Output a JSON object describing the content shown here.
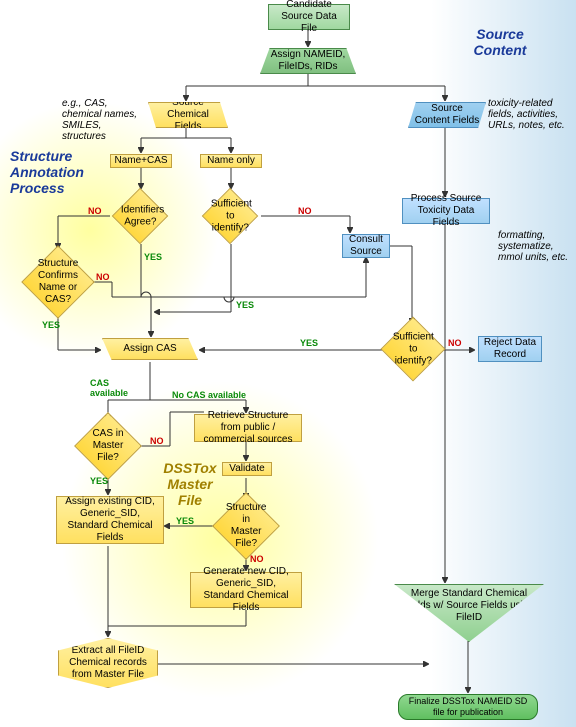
{
  "titles": {
    "left": "Structure Annotation Process",
    "right": "Source Content",
    "master": "DSSTox Master File"
  },
  "nodes": {
    "start": "Candidate Source Data File",
    "assign_ids": "Assign NAMEID, FileIDs, RIDs",
    "src_chem": "Source Chemical Fields",
    "src_cont": "Source Content Fields",
    "name_cas": "Name+CAS",
    "name_only": "Name only",
    "id_agree": "Identifiers Agree?",
    "suff1": "Sufficient to identify?",
    "struct_conf": "Structure Confirms Name or CAS?",
    "consult": "Consult Source",
    "suff2": "Sufficient to identify?",
    "reject": "Reject Data Record",
    "process_tox": "Process Source Toxicity Data Fields",
    "assign_cas": "Assign CAS",
    "cas_master": "CAS in Master File?",
    "retrieve": "Retrieve Structure from public / commercial sources",
    "validate": "Validate",
    "struct_master": "Structure in Master File?",
    "assign_exist": "Assign existing CID, Generic_SID, Standard Chemical Fields",
    "gen_new": "Generate new CID, Generic_SID, Standard Chemical Fields",
    "extract": "Extract all FileID Chemical records from Master File",
    "merge": "Merge Standard Chemical Fields w/ Source Fields using FileID",
    "final": "Finalize DSSTox NAMEID SD file for publication"
  },
  "notes": {
    "chem_eg": "e.g., CAS, chemical names, SMILES, structures",
    "tox_eg": "toxicity-related fields, activities, URLs, notes, etc.",
    "fmt": "formatting, systematize, mmol units, etc."
  },
  "lbl": {
    "yes": "YES",
    "no": "NO",
    "cas_av": "CAS available",
    "no_cas": "No CAS available"
  }
}
